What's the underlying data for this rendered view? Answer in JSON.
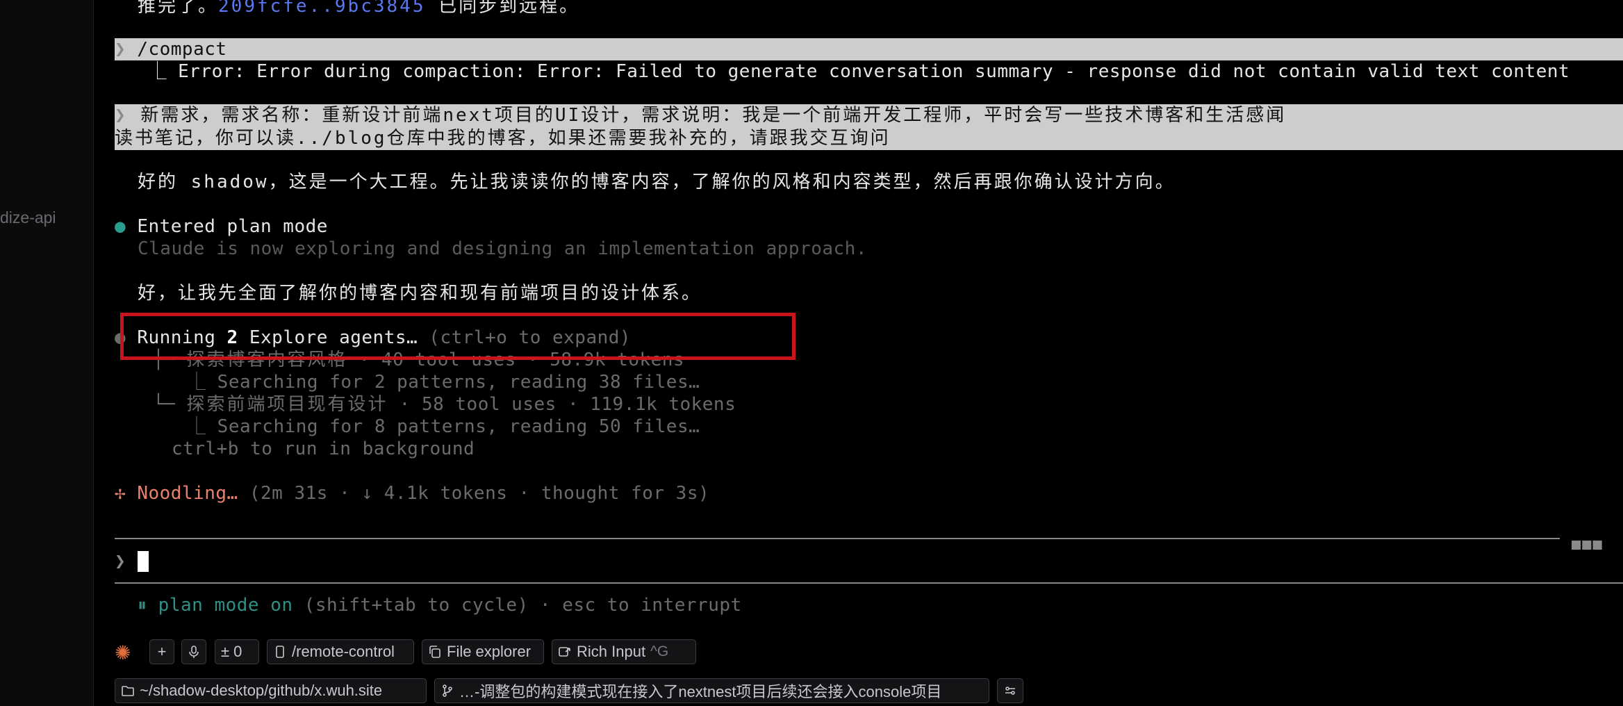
{
  "sidebar": {
    "partial_label": "dize-api"
  },
  "top_line": {
    "prefix": "推完了。",
    "hash": "209fcfe..9bc3845",
    "suffix": " 已同步到远程。"
  },
  "compact": {
    "prompt_glyph": "❯",
    "command": "/compact",
    "branch_glyph": "⎿",
    "error": "Error: Error during compaction: Error: Failed to generate conversation summary - response did not contain valid text content"
  },
  "request": {
    "line1": "新需求，需求名称：重新设计前端next项目的UI设计，需求说明：我是一个前端开发工程师，平时会写一些技术博客和生活感闻",
    "line2": "读书笔记，你可以读../blog仓库中我的博客，如果还需要我补充的，请跟我交互询问"
  },
  "reply1": "好的 shadow，这是一个大工程。先让我读读你的博客内容，了解你的风格和内容类型，然后再跟你确认设计方向。",
  "plan": {
    "bullet": "●",
    "title": "Entered plan mode",
    "subtitle": "Claude is now exploring and designing an implementation approach."
  },
  "reply2": "好，让我先全面了解你的博客内容和现有前端项目的设计体系。",
  "agents": {
    "bullet": "●",
    "running_prefix": "Running ",
    "count": "2",
    "running_suffix": " Explore agents…",
    "hint": " (ctrl+o to expand)",
    "tree": [
      {
        "glyph": "├─",
        "label": "探索博客内容风格",
        "meta": " · 40 tool uses · 58.9k tokens"
      },
      {
        "glyph": "⎿",
        "label": "Searching for 2 patterns, reading 38 files…",
        "meta": ""
      },
      {
        "glyph": "└─",
        "label": "探索前端项目现有设计",
        "meta": " · 58 tool uses · 119.1k tokens"
      },
      {
        "glyph": "⎿",
        "label": "Searching for 8 patterns, reading 50 files…",
        "meta": ""
      }
    ],
    "background_hint": "ctrl+b to run in background"
  },
  "status": {
    "glyph": "✢",
    "label": "Noodling…",
    "meta": " (2m 31s · ↓ 4.1k tokens · thought for 3s)"
  },
  "input": {
    "prompt_glyph": "❯",
    "value": ""
  },
  "footer": {
    "mode_glyph": "⏸",
    "mode": "plan mode on",
    "hint": " (shift+tab to cycle) · esc to interrupt"
  },
  "toolbar": {
    "add_label": "+",
    "diff_label": "± 0",
    "remote_label": "/remote-control",
    "file_explorer_label": "File explorer",
    "rich_input_label": "Rich Input",
    "rich_input_shortcut": "^G",
    "path_label": "~/shadow-desktop/github/x.wuh.site",
    "branch_label": "…-调整包的构建模式现在接入了nextnest项目后续还会接入console项目"
  },
  "colors": {
    "background": "#000000",
    "hash": "#5a78f0",
    "plan_teal": "#2a9d8f",
    "status_orange": "#e8826d",
    "highlight_box": "#c8151b",
    "selection_bg": "#cdcdcd"
  }
}
